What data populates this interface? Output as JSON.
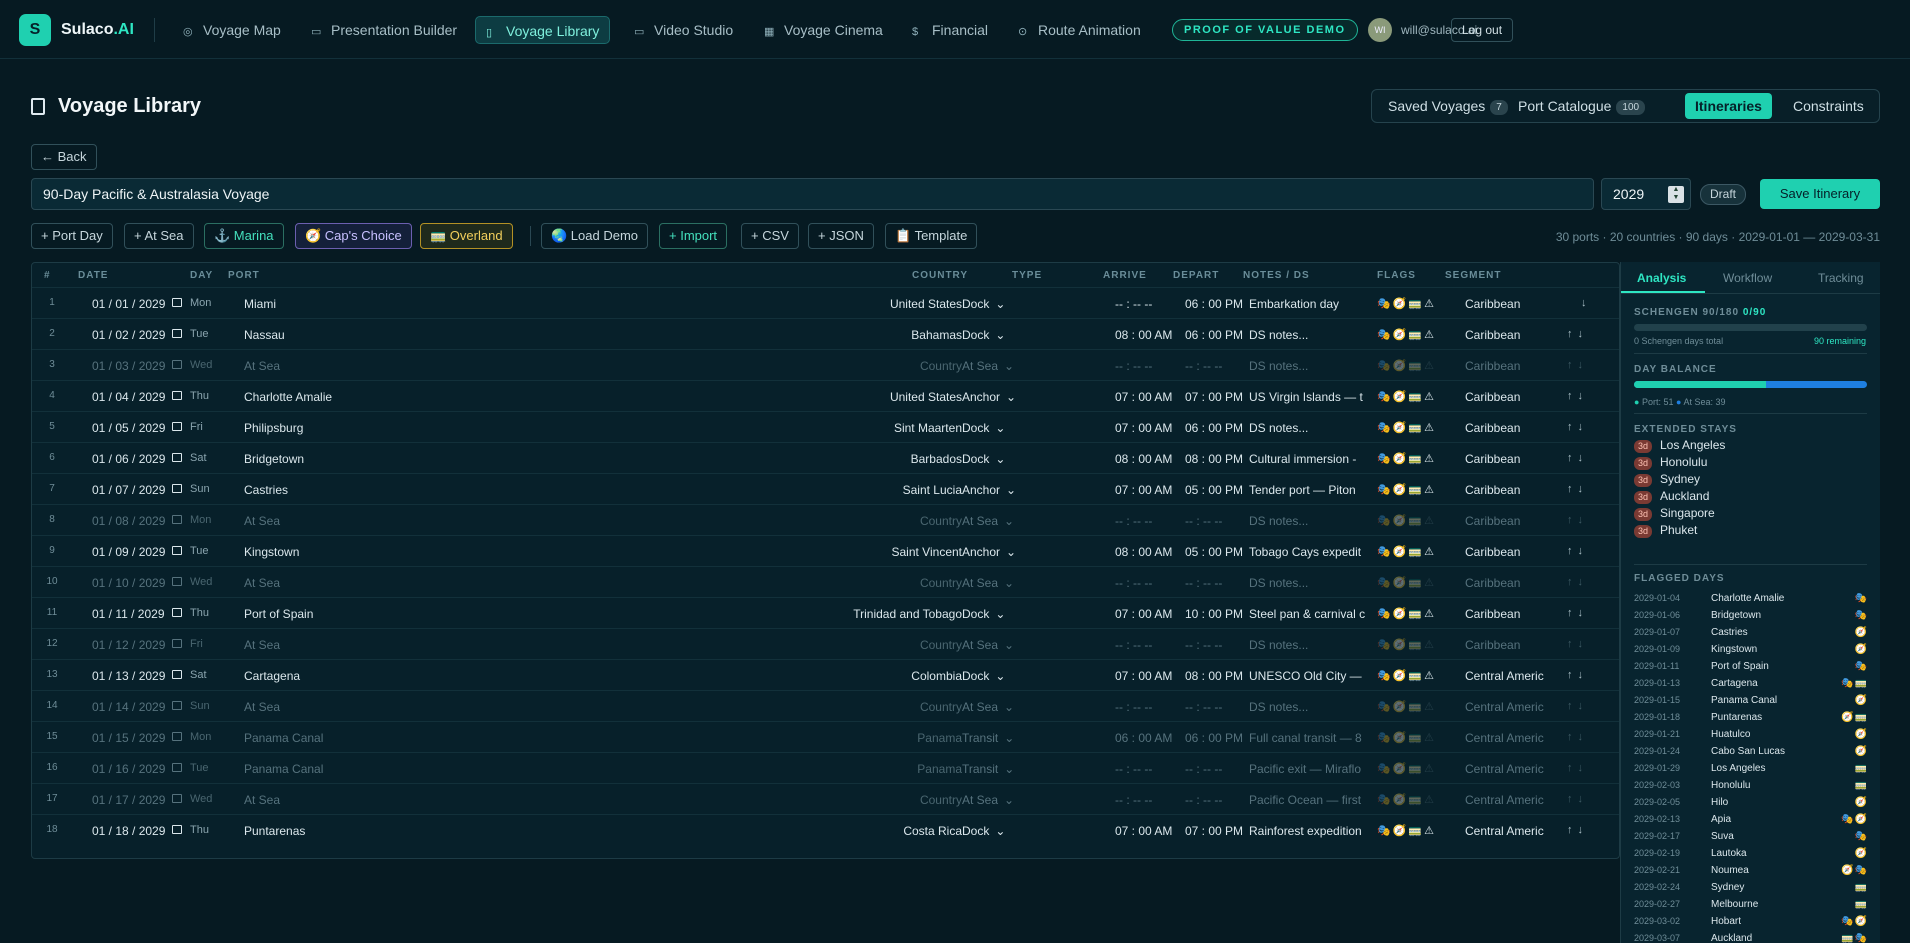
{
  "app": {
    "logo_letter": "S",
    "brand_main": "Sulaco",
    "brand_accent": ".AI"
  },
  "nav": [
    {
      "label": "Voyage Map",
      "icon": "globe-icon"
    },
    {
      "label": "Presentation Builder",
      "icon": "monitor-icon"
    },
    {
      "label": "Voyage Library",
      "icon": "book-icon",
      "active": true
    },
    {
      "label": "Video Studio",
      "icon": "video-icon"
    },
    {
      "label": "Voyage Cinema",
      "icon": "film-icon"
    },
    {
      "label": "Financial",
      "icon": "dollar-icon"
    },
    {
      "label": "Route Animation",
      "icon": "route-icon"
    }
  ],
  "demo_badge": "PROOF OF VALUE DEMO",
  "user": {
    "initials": "WI",
    "email": "will@sulaco.ai",
    "logout": "Log out"
  },
  "page": {
    "title": "Voyage Library"
  },
  "top_tabs": [
    {
      "label": "Saved Voyages",
      "count": "7"
    },
    {
      "label": "Port Catalogue",
      "count": "100"
    },
    {
      "label": "Itineraries",
      "active": true
    },
    {
      "label": "Constraints"
    }
  ],
  "back": "← Back",
  "itinerary": {
    "name": "90-Day Pacific & Australasia Voyage",
    "year": "2029",
    "status": "Draft",
    "save": "Save Itinerary"
  },
  "toolbar": {
    "port_day": "+ Port Day",
    "at_sea": "+ At Sea",
    "marina": "⚓ Marina",
    "caps_choice": "🧭 Cap's Choice",
    "overland": "🚃 Overland",
    "load_demo": "🌏 Load Demo",
    "import": "+ Import",
    "csv": "+ CSV",
    "json": "+ JSON",
    "template": "📋 Template"
  },
  "summary": "30 ports · 20 countries · 90 days · 2029-01-01 — 2029-03-31",
  "table": {
    "headers": [
      "#",
      "DATE",
      "DAY",
      "PORT",
      "COUNTRY",
      "TYPE",
      "ARRIVE",
      "DEPART",
      "NOTES / DS",
      "FLAGS",
      "SEGMENT"
    ],
    "rows": [
      {
        "n": "1",
        "date": "01 / 01 / 2029",
        "day": "Mon",
        "port": "Miami",
        "country": "United States",
        "type": "Dock",
        "arrive": "-- : --   --",
        "depart": "06 : 00   PM",
        "notes": "Embarkation day",
        "flags": "🎭🧭🚃⚠",
        "segment": "Caribbean",
        "sea": false
      },
      {
        "n": "2",
        "date": "01 / 02 / 2029",
        "day": "Tue",
        "port": "Nassau",
        "country": "Bahamas",
        "type": "Dock",
        "arrive": "08 : 00   AM",
        "depart": "06 : 00   PM",
        "notes": "DS notes...",
        "flags": "🎭🧭🚃⚠",
        "segment": "Caribbean",
        "sea": false
      },
      {
        "n": "3",
        "date": "01 / 03 / 2029",
        "day": "Wed",
        "port": "At Sea",
        "country": "Country",
        "type": "At Sea",
        "arrive": "-- : --   --",
        "depart": "-- : --   --",
        "notes": "DS notes...",
        "flags": "🎭🧭🚃⚠",
        "segment": "Caribbean",
        "sea": true
      },
      {
        "n": "4",
        "date": "01 / 04 / 2029",
        "day": "Thu",
        "port": "Charlotte Amalie",
        "country": "United States",
        "type": "Anchor",
        "arrive": "07 : 00   AM",
        "depart": "07 : 00   PM",
        "notes": "US Virgin Islands — t",
        "flags": "🎭🧭🚃⚠",
        "segment": "Caribbean",
        "sea": false
      },
      {
        "n": "5",
        "date": "01 / 05 / 2029",
        "day": "Fri",
        "port": "Philipsburg",
        "country": "Sint Maarten",
        "type": "Dock",
        "arrive": "07 : 00   AM",
        "depart": "06 : 00   PM",
        "notes": "DS notes...",
        "flags": "🎭🧭🚃⚠",
        "segment": "Caribbean",
        "sea": false
      },
      {
        "n": "6",
        "date": "01 / 06 / 2029",
        "day": "Sat",
        "port": "Bridgetown",
        "country": "Barbados",
        "type": "Dock",
        "arrive": "08 : 00   AM",
        "depart": "08 : 00   PM",
        "notes": "Cultural immersion -",
        "flags": "🎭🧭🚃⚠",
        "segment": "Caribbean",
        "sea": false
      },
      {
        "n": "7",
        "date": "01 / 07 / 2029",
        "day": "Sun",
        "port": "Castries",
        "country": "Saint Lucia",
        "type": "Anchor",
        "arrive": "07 : 00   AM",
        "depart": "05 : 00   PM",
        "notes": "Tender port — Piton",
        "flags": "🎭🧭🚃⚠",
        "segment": "Caribbean",
        "sea": false
      },
      {
        "n": "8",
        "date": "01 / 08 / 2029",
        "day": "Mon",
        "port": "At Sea",
        "country": "Country",
        "type": "At Sea",
        "arrive": "-- : --   --",
        "depart": "-- : --   --",
        "notes": "DS notes...",
        "flags": "🎭🧭🚃⚠",
        "segment": "Caribbean",
        "sea": true
      },
      {
        "n": "9",
        "date": "01 / 09 / 2029",
        "day": "Tue",
        "port": "Kingstown",
        "country": "Saint Vincent",
        "type": "Anchor",
        "arrive": "08 : 00   AM",
        "depart": "05 : 00   PM",
        "notes": "Tobago Cays expedit",
        "flags": "🎭🧭🚃⚠",
        "segment": "Caribbean",
        "sea": false
      },
      {
        "n": "10",
        "date": "01 / 10 / 2029",
        "day": "Wed",
        "port": "At Sea",
        "country": "Country",
        "type": "At Sea",
        "arrive": "-- : --   --",
        "depart": "-- : --   --",
        "notes": "DS notes...",
        "flags": "🎭🧭🚃⚠",
        "segment": "Caribbean",
        "sea": true
      },
      {
        "n": "11",
        "date": "01 / 11 / 2029",
        "day": "Thu",
        "port": "Port of Spain",
        "country": "Trinidad and Tobago",
        "type": "Dock",
        "arrive": "07 : 00   AM",
        "depart": "10 : 00   PM",
        "notes": "Steel pan & carnival c",
        "flags": "🎭🧭🚃⚠",
        "segment": "Caribbean",
        "sea": false
      },
      {
        "n": "12",
        "date": "01 / 12 / 2029",
        "day": "Fri",
        "port": "At Sea",
        "country": "Country",
        "type": "At Sea",
        "arrive": "-- : --   --",
        "depart": "-- : --   --",
        "notes": "DS notes...",
        "flags": "🎭🧭🚃⚠",
        "segment": "Caribbean",
        "sea": true
      },
      {
        "n": "13",
        "date": "01 / 13 / 2029",
        "day": "Sat",
        "port": "Cartagena",
        "country": "Colombia",
        "type": "Dock",
        "arrive": "07 : 00   AM",
        "depart": "08 : 00   PM",
        "notes": "UNESCO Old City —",
        "flags": "🎭🧭🚃⚠",
        "segment": "Central Americ",
        "sea": false
      },
      {
        "n": "14",
        "date": "01 / 14 / 2029",
        "day": "Sun",
        "port": "At Sea",
        "country": "Country",
        "type": "At Sea",
        "arrive": "-- : --   --",
        "depart": "-- : --   --",
        "notes": "DS notes...",
        "flags": "🎭🧭🚃⚠",
        "segment": "Central Americ",
        "sea": true
      },
      {
        "n": "15",
        "date": "01 / 15 / 2029",
        "day": "Mon",
        "port": "Panama Canal",
        "country": "Panama",
        "type": "Transit",
        "arrive": "06 : 00   AM",
        "depart": "06 : 00   PM",
        "notes": "Full canal transit — 8",
        "flags": "🎭🧭🚃⚠",
        "segment": "Central Americ",
        "sea": true
      },
      {
        "n": "16",
        "date": "01 / 16 / 2029",
        "day": "Tue",
        "port": "Panama Canal",
        "country": "Panama",
        "type": "Transit",
        "arrive": "-- : --   --",
        "depart": "-- : --   --",
        "notes": "Pacific exit — Miraflo",
        "flags": "🎭🧭🚃⚠",
        "segment": "Central Americ",
        "sea": true
      },
      {
        "n": "17",
        "date": "01 / 17 / 2029",
        "day": "Wed",
        "port": "At Sea",
        "country": "Country",
        "type": "At Sea",
        "arrive": "-- : --   --",
        "depart": "-- : --   --",
        "notes": "Pacific Ocean — first",
        "flags": "🎭🧭🚃⚠",
        "segment": "Central Americ",
        "sea": true
      },
      {
        "n": "18",
        "date": "01 / 18 / 2029",
        "day": "Thu",
        "port": "Puntarenas",
        "country": "Costa Rica",
        "type": "Dock",
        "arrive": "07 : 00   AM",
        "depart": "07 : 00   PM",
        "notes": "Rainforest expedition",
        "flags": "🎭🧭🚃⚠",
        "segment": "Central Americ",
        "sea": false
      }
    ]
  },
  "side": {
    "tabs": [
      "Analysis",
      "Workflow",
      "Tracking"
    ],
    "schengen_label": "SCHENGEN 90/180",
    "schengen_value": "0/90",
    "schengen_fill": 0.0,
    "schengen_total": "0 Schengen days total",
    "schengen_remaining": "90 remaining",
    "day_balance_label": "DAY BALANCE",
    "port_days": "Port: 51",
    "sea_days": "At Sea: 39",
    "port_fraction": 0.567,
    "extended_label": "EXTENDED STAYS",
    "extended": [
      {
        "d": "3d",
        "port": "Los Angeles"
      },
      {
        "d": "3d",
        "port": "Honolulu"
      },
      {
        "d": "3d",
        "port": "Sydney"
      },
      {
        "d": "3d",
        "port": "Auckland"
      },
      {
        "d": "3d",
        "port": "Singapore"
      },
      {
        "d": "3d",
        "port": "Phuket"
      }
    ],
    "flagged_label": "FLAGGED DAYS",
    "flagged": [
      {
        "date": "2029-01-04",
        "port": "Charlotte Amalie",
        "f": "🎭"
      },
      {
        "date": "2029-01-06",
        "port": "Bridgetown",
        "f": "🎭"
      },
      {
        "date": "2029-01-07",
        "port": "Castries",
        "f": "🧭"
      },
      {
        "date": "2029-01-09",
        "port": "Kingstown",
        "f": "🧭"
      },
      {
        "date": "2029-01-11",
        "port": "Port of Spain",
        "f": "🎭"
      },
      {
        "date": "2029-01-13",
        "port": "Cartagena",
        "f": "🎭🚃"
      },
      {
        "date": "2029-01-15",
        "port": "Panama Canal",
        "f": "🧭"
      },
      {
        "date": "2029-01-18",
        "port": "Puntarenas",
        "f": "🧭🚃"
      },
      {
        "date": "2029-01-21",
        "port": "Huatulco",
        "f": "🧭"
      },
      {
        "date": "2029-01-24",
        "port": "Cabo San Lucas",
        "f": "🧭"
      },
      {
        "date": "2029-01-29",
        "port": "Los Angeles",
        "f": "🚃"
      },
      {
        "date": "2029-02-03",
        "port": "Honolulu",
        "f": "🚃"
      },
      {
        "date": "2029-02-05",
        "port": "Hilo",
        "f": "🧭"
      },
      {
        "date": "2029-02-13",
        "port": "Apia",
        "f": "🎭🧭"
      },
      {
        "date": "2029-02-17",
        "port": "Suva",
        "f": "🎭"
      },
      {
        "date": "2029-02-19",
        "port": "Lautoka",
        "f": "🧭"
      },
      {
        "date": "2029-02-21",
        "port": "Noumea",
        "f": "🧭🎭"
      },
      {
        "date": "2029-02-24",
        "port": "Sydney",
        "f": "🚃"
      },
      {
        "date": "2029-02-27",
        "port": "Melbourne",
        "f": "🚃"
      },
      {
        "date": "2029-03-02",
        "port": "Hobart",
        "f": "🎭🧭"
      },
      {
        "date": "2029-03-07",
        "port": "Auckland",
        "f": "🚃🎭"
      }
    ]
  }
}
